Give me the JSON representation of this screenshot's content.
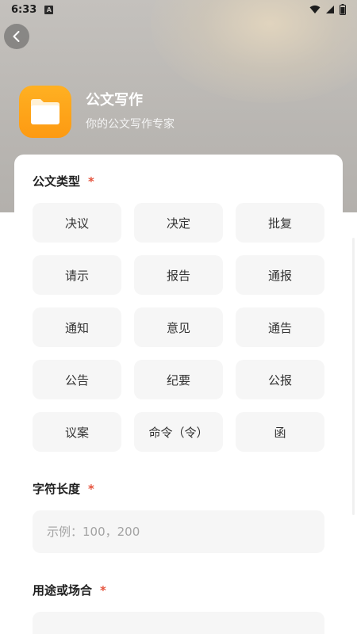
{
  "status_bar": {
    "time": "6:33",
    "notif_badge": "A"
  },
  "header": {
    "app_title": "公文写作",
    "app_subtitle": "你的公文写作专家",
    "logo_icon": "folder-icon",
    "accent_color": "#fd9a12"
  },
  "doc_type": {
    "label": "公文类型",
    "required_mark": "*",
    "options": [
      "决议",
      "决定",
      "批复",
      "请示",
      "报告",
      "通报",
      "通知",
      "意见",
      "通告",
      "公告",
      "纪要",
      "公报",
      "议案",
      "命令（令）",
      "函"
    ]
  },
  "char_length": {
    "label": "字符长度",
    "required_mark": "*",
    "placeholder": "示例：100，200"
  },
  "usage": {
    "label": "用途或场合",
    "required_mark": "*",
    "placeholder": ""
  },
  "colors": {
    "required": "#e5533d",
    "chip_bg": "#f6f6f6"
  }
}
